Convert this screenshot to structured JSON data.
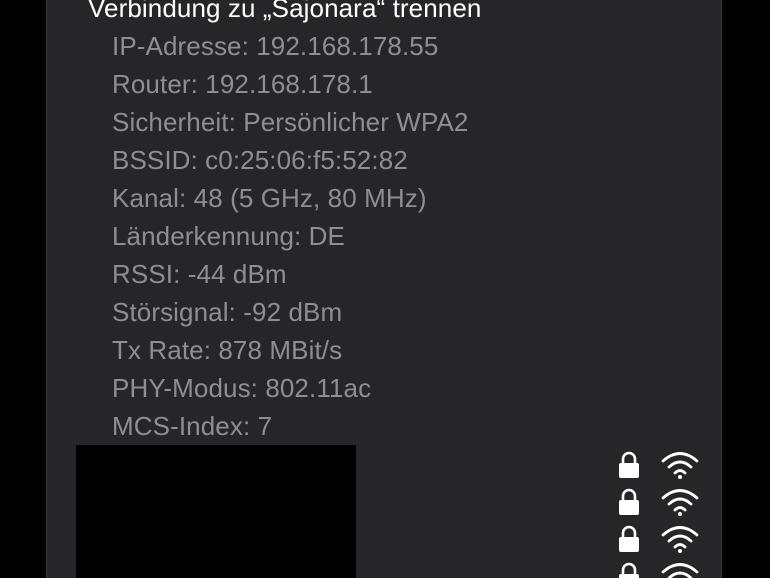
{
  "menu": {
    "disconnect_label": "Verbindung zu „Sajonara“ trennen",
    "details": [
      "IP-Adresse: 192.168.178.55",
      "Router: 192.168.178.1",
      "Sicherheit: Persönlicher WPA2",
      "BSSID: c0:25:06:f5:52:82",
      "Kanal: 48 (5 GHz, 80 MHz)",
      "Länderkennung: DE",
      "RSSI: -44 dBm",
      "Störsignal: -92 dBm",
      "Tx Rate: 878 MBit/s",
      "PHY-Modus: 802.11ac",
      "MCS-Index: 7"
    ]
  },
  "networks": [
    {
      "secured_icon": "lock-icon",
      "signal_icon": "wifi-icon"
    },
    {
      "secured_icon": "lock-icon",
      "signal_icon": "wifi-icon"
    },
    {
      "secured_icon": "lock-icon",
      "signal_icon": "wifi-icon"
    },
    {
      "secured_icon": "lock-icon",
      "signal_icon": "wifi-icon"
    }
  ],
  "colors": {
    "panel_background": "#262628",
    "primary_text": "#ffffff",
    "secondary_text": "#8e8e93",
    "outer_background": "#000000"
  }
}
